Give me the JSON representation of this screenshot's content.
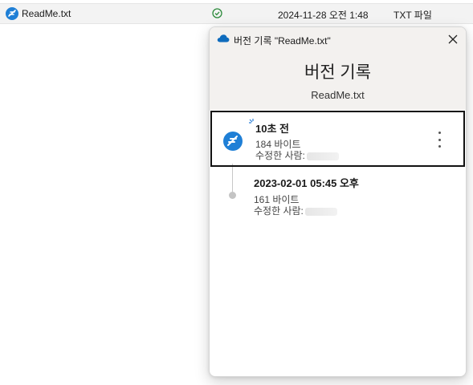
{
  "file_row": {
    "name": "ReadMe.txt",
    "date": "2024-11-28 오전 1:48",
    "type": "TXT 파일",
    "icons": [
      "app-feather-icon",
      "sync-check-icon"
    ]
  },
  "panel": {
    "title": "버전 기록 \"ReadMe.txt\"",
    "heading": "버전 기록",
    "subheading": "ReadMe.txt",
    "icons": [
      "onedrive-cloud-icon",
      "close-icon"
    ],
    "versions": [
      {
        "label": "10초 전",
        "size": "184 바이트",
        "modified_by": "수정한 사람:"
      },
      {
        "label": "2023-02-01 05:45 오후",
        "size": "161 바이트",
        "modified_by": "수정한 사람:"
      }
    ]
  },
  "colors": {
    "accent": "#0f6cbd",
    "sync_green": "#2e8b3d",
    "panel_header_bg": "#f3f1ef"
  }
}
